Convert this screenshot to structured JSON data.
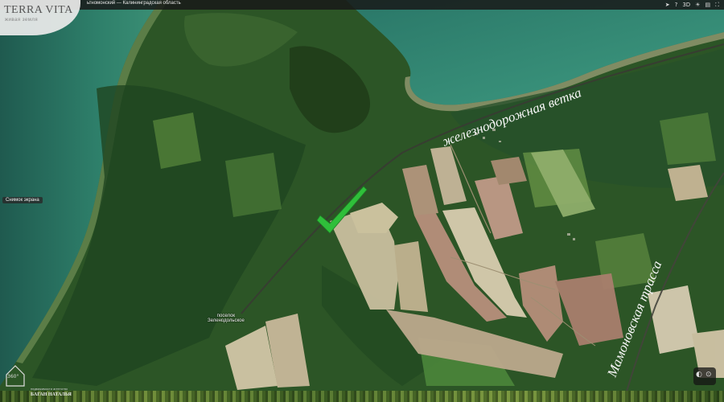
{
  "header": {
    "title": "ьтномонский — Калининградская область",
    "tools": [
      "send-icon",
      "help-icon",
      "3D",
      "sun-icon",
      "layers-icon",
      "fullscreen-icon"
    ]
  },
  "logo": {
    "name": "TERRA VITA",
    "subtitle": "живая земля"
  },
  "screenshot_button": "Снимок экрана",
  "map": {
    "settlement": [
      "поселок",
      "Зеленодольское"
    ],
    "railway_label": "железнодорожная ветка",
    "highway_label": "Мамоновская трасса",
    "marker": "green-checkmark-icon"
  },
  "brand": {
    "degree_label": "360°",
    "agency_line": "недвижимости агентство",
    "person_name": "БАГАН НАТАЛЬЯ"
  },
  "colors": {
    "water": "#2e7d6b",
    "forest": "#24481f",
    "field": "#b8a98c",
    "marker": "#2fbf3a"
  }
}
